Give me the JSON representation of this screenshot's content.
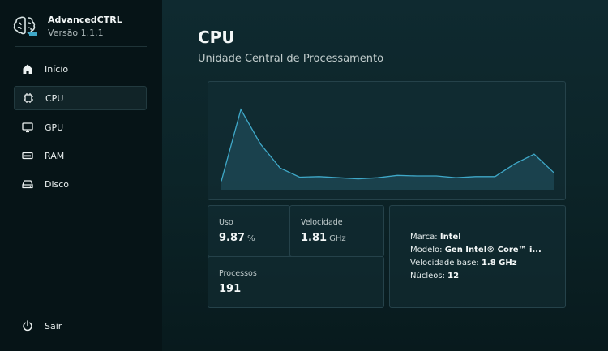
{
  "app": {
    "name": "AdvancedCTRL",
    "version": "Versão 1.1.1"
  },
  "sidebar": {
    "items": [
      {
        "label": "Início",
        "icon": "home-icon"
      },
      {
        "label": "CPU",
        "icon": "cpu-icon",
        "active": true
      },
      {
        "label": "GPU",
        "icon": "monitor-icon"
      },
      {
        "label": "RAM",
        "icon": "memory-icon"
      },
      {
        "label": "Disco",
        "icon": "disk-icon"
      }
    ],
    "exit_label": "Sair",
    "exit_icon": "power-icon"
  },
  "page": {
    "title": "CPU",
    "subtitle": "Unidade Central de Processamento"
  },
  "usage_chart": {
    "type": "area",
    "values": [
      1.5,
      14,
      8,
      3.8,
      2.2,
      2.3,
      2.1,
      1.9,
      2.1,
      2.5,
      2.4,
      2.4,
      2.1,
      2.3,
      2.3,
      4.5,
      6.2,
      3
    ],
    "max": 16,
    "line_color": "#3fa8c8",
    "fill_color": "#1d4a57"
  },
  "stats": {
    "usage_label": "Uso",
    "usage_value": "9.87",
    "usage_unit": "%",
    "speed_label": "Velocidade",
    "speed_value": "1.81",
    "speed_unit": "GHz",
    "processes_label": "Processos",
    "processes_value": "191"
  },
  "info": {
    "brand_label": "Marca:",
    "brand_value": "Intel",
    "model_label": "Modelo:",
    "model_value": "Gen Intel® Core™ i...",
    "base_speed_label": "Velocidade base:",
    "base_speed_value": "1.8 GHz",
    "cores_label": "Núcleos:",
    "cores_value": "12"
  },
  "colors": {
    "accent": "#3fa8c8",
    "sidebar_bg": "#061417",
    "main_bg": "#0f2a30"
  }
}
